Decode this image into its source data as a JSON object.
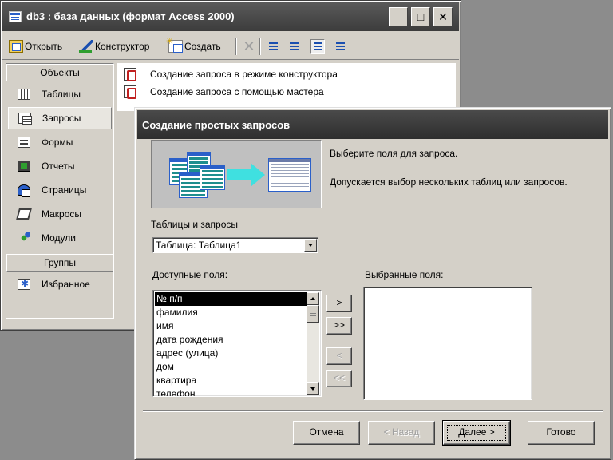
{
  "db_window": {
    "title": "db3 : база данных (формат Access 2000)",
    "window_buttons": {
      "minimize": "_",
      "maximize": "□",
      "close": "✕"
    },
    "toolbar": {
      "open_label": "Открыть",
      "design_label": "Конструктор",
      "create_label": "Создать"
    },
    "objects_header": "Объекты",
    "objects": [
      {
        "label": "Таблицы",
        "icon": "table-icon"
      },
      {
        "label": "Запросы",
        "icon": "query-icon",
        "selected": true
      },
      {
        "label": "Формы",
        "icon": "form-icon"
      },
      {
        "label": "Отчеты",
        "icon": "report-icon"
      },
      {
        "label": "Страницы",
        "icon": "page-icon"
      },
      {
        "label": "Макросы",
        "icon": "macro-icon"
      },
      {
        "label": "Модули",
        "icon": "module-icon"
      }
    ],
    "groups_header": "Группы",
    "groups": [
      {
        "label": "Избранное",
        "icon": "favorites-icon"
      }
    ],
    "list_items": [
      {
        "label": "Создание запроса в режиме конструктора",
        "icon": "wizard-shortcut-icon"
      },
      {
        "label": "Создание запроса с помощью мастера",
        "icon": "wizard-shortcut-icon"
      }
    ]
  },
  "wizard": {
    "title": "Создание простых запросов",
    "instruction_1": "Выберите поля для запроса.",
    "instruction_2": "Допускается выбор нескольких таблиц или запросов.",
    "tables_label": "Таблицы и запросы",
    "tables_value": "Таблица: Таблица1",
    "available_label": "Доступные поля:",
    "selected_label": "Выбранные поля:",
    "available_fields": [
      "№ п/п",
      "фамилия",
      "имя",
      "дата рождения",
      "адрес (улица)",
      "дом",
      "квартира",
      "телефон"
    ],
    "selected_field_index": 0,
    "move_buttons": {
      "add_one": ">",
      "add_all": ">>",
      "remove_one": "<",
      "remove_all": "<<"
    },
    "buttons": {
      "cancel": "Отмена",
      "back": "< Назад",
      "next": "Далее >",
      "finish": "Готово"
    }
  },
  "colors": {
    "dialog_face": "#d4d0c8",
    "titlebar": "#3c3c3c",
    "accent_arrow": "#3fe0e0",
    "selection": "#000000"
  }
}
